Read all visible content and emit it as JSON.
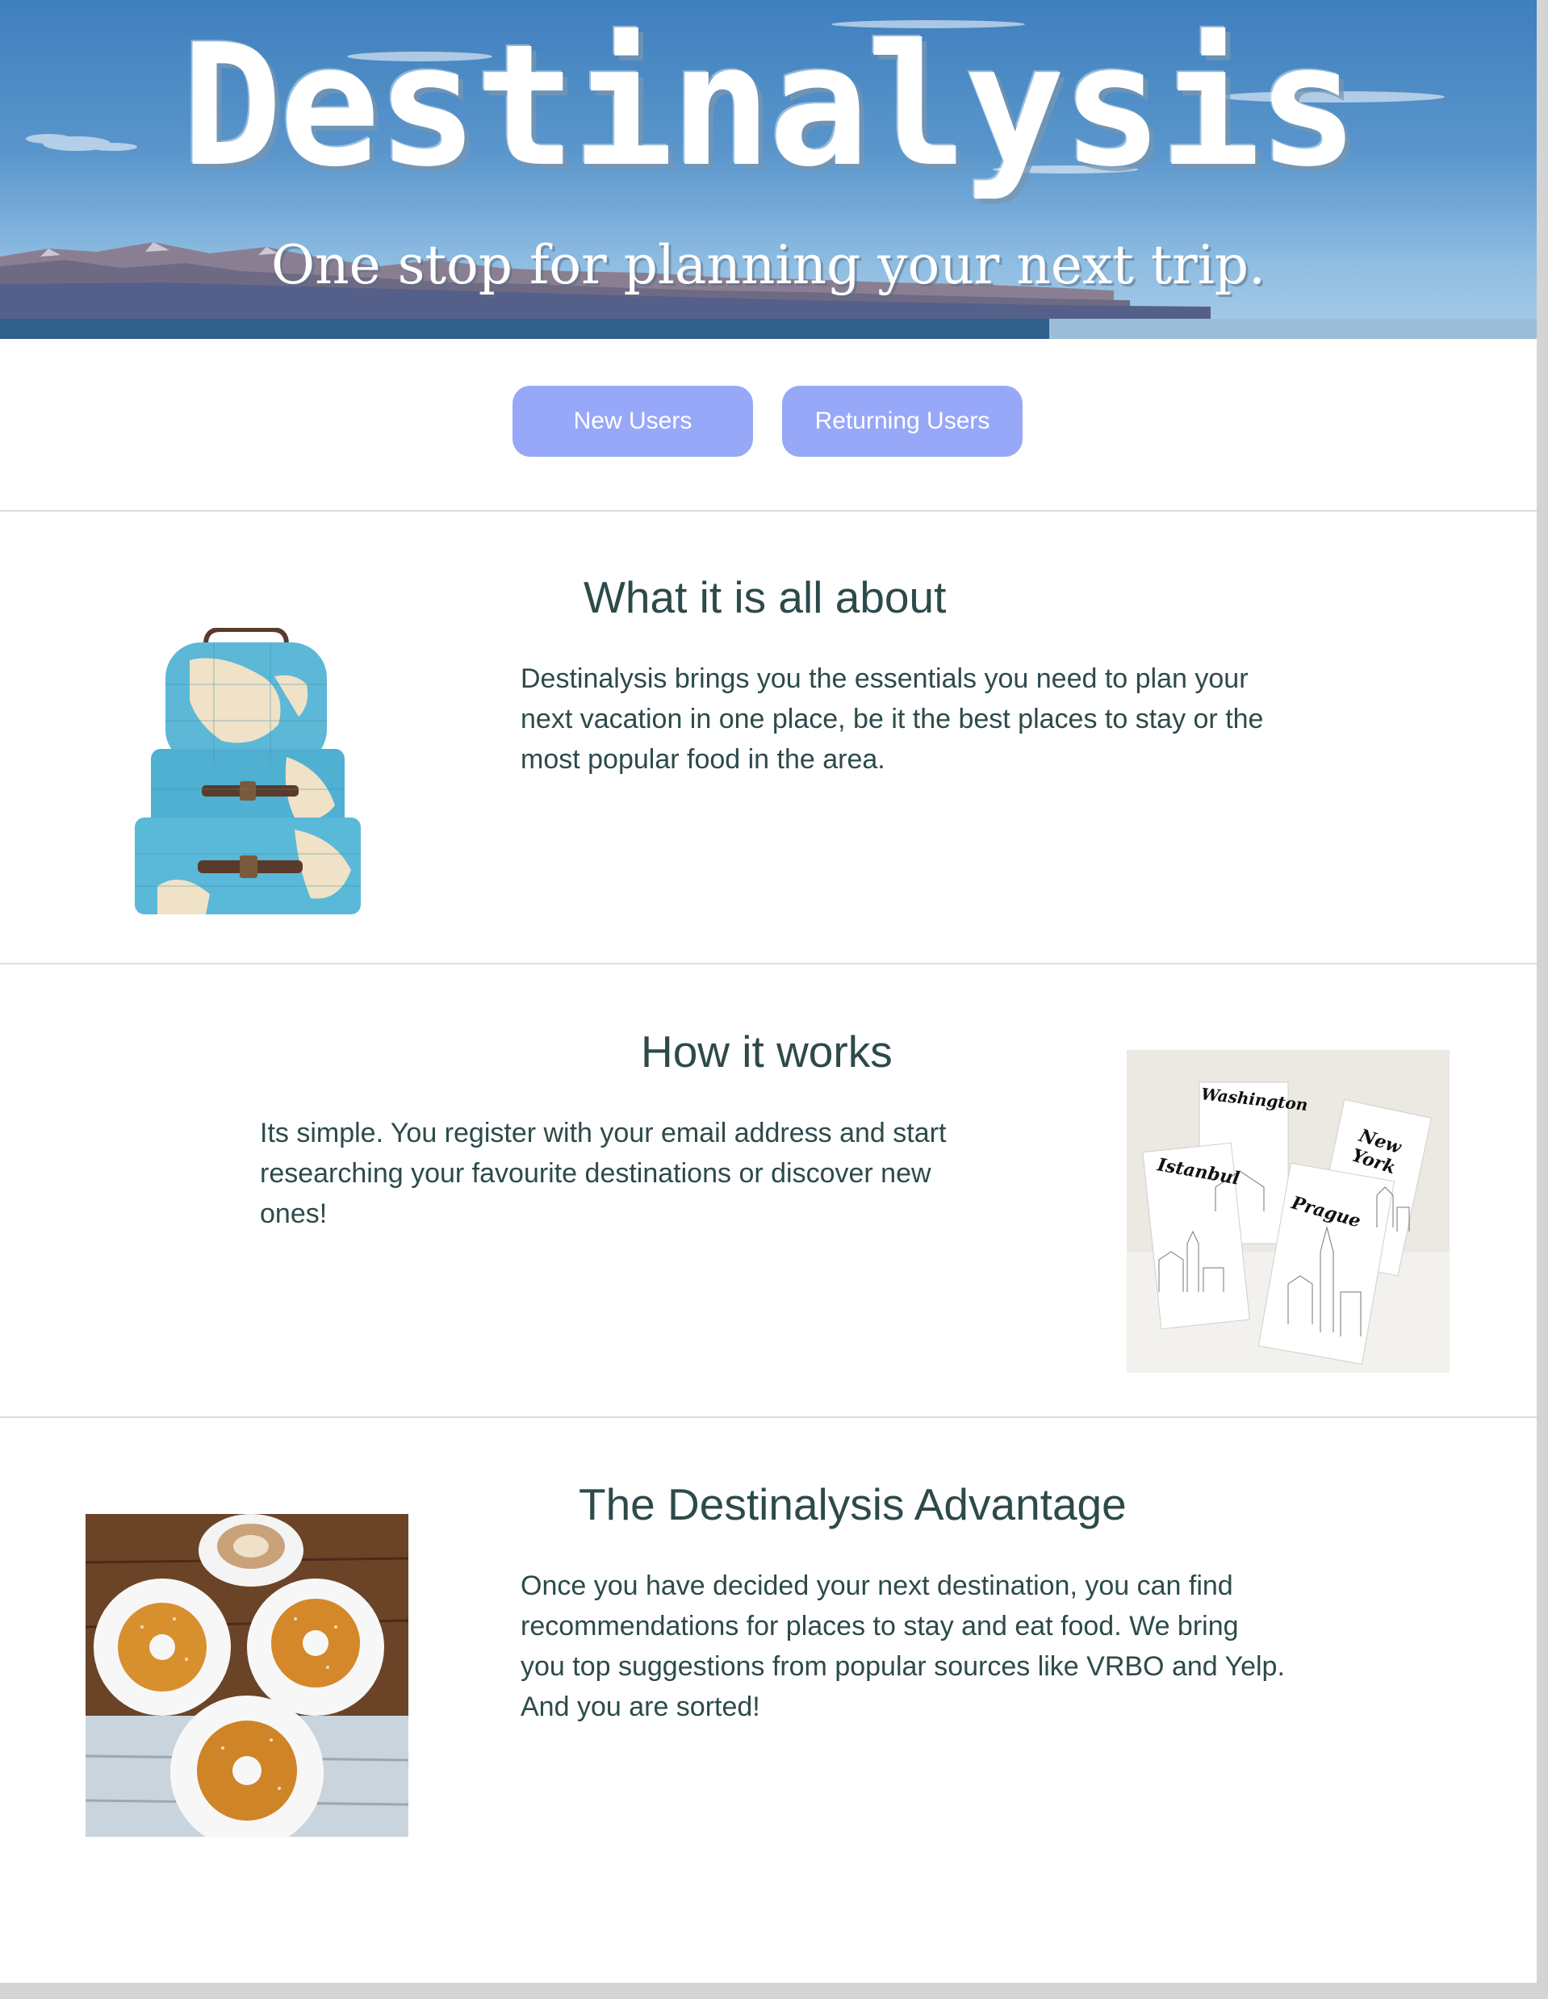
{
  "hero": {
    "title": "Destinalysis",
    "tagline": "One stop for planning your next trip."
  },
  "buttons": {
    "new_users": "New Users",
    "returning_users": "Returning Users"
  },
  "about": {
    "heading": "What it is all about",
    "text": "Destinalysis brings you the essentials you need to plan your next vacation in one place, be it the best places to stay or the most popular food in the area."
  },
  "how": {
    "heading": "How it works",
    "text": "Its simple. You register with your email address and start researching your favourite destinations or discover new ones!",
    "cards": [
      "Washington",
      "New York",
      "Istanbul",
      "Prague"
    ]
  },
  "advantage": {
    "heading": "The Destinalysis Advantage",
    "text": "Once you have decided your next destination, you can find recommendations for places to stay and eat food. We bring you top suggestions from popular sources like VRBO and Yelp. And you are sorted!"
  },
  "colors": {
    "button_bg": "#98a8f8",
    "text": "#2d4a4a",
    "divider": "#dcdcdc"
  }
}
